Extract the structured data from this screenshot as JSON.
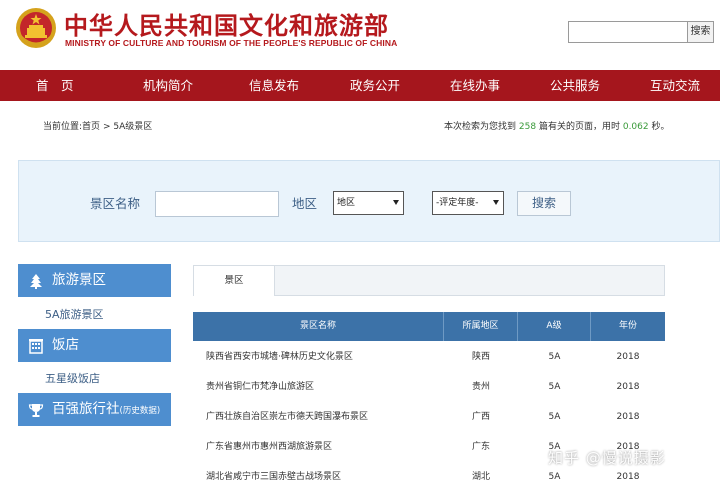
{
  "header": {
    "title_cn": "中华人民共和国文化和旅游部",
    "title_en": "MINISTRY OF CULTURE AND TOURISM OF THE PEOPLE'S REPUBLIC OF CHINA",
    "search_placeholder": "",
    "search_button": "搜索"
  },
  "nav": {
    "items": [
      "首　页",
      "机构简介",
      "信息发布",
      "政务公开",
      "在线办事",
      "公共服务",
      "互动交流"
    ]
  },
  "breadcrumb": {
    "prefix": "当前位置:",
    "home": "首页",
    "separator": ">",
    "current": "5A级景区"
  },
  "result": {
    "before": "本次检索为您找到",
    "count": "258",
    "middle": "篇有关的页面，用时",
    "time": "0.062",
    "unit": "秒。"
  },
  "filter": {
    "name_label": "景区名称",
    "name_value": "",
    "region_label": "地区",
    "region_selected": "地区",
    "year_selected": "-评定年度-",
    "search_button": "搜索"
  },
  "sidebar": {
    "sections": [
      {
        "title": "旅游景区",
        "icon": "tree-icon",
        "sub": "5A旅游景区"
      },
      {
        "title": "饭店",
        "icon": "building-icon",
        "sub": "五星级饭店"
      },
      {
        "title": "百强旅行社",
        "note": "(历史数据)",
        "icon": "trophy-icon"
      }
    ]
  },
  "tabs": {
    "active": "景区"
  },
  "table": {
    "headers": [
      "景区名称",
      "所属地区",
      "A级",
      "年份"
    ],
    "rows": [
      [
        "陕西省西安市城墙·碑林历史文化景区",
        "陕西",
        "5A",
        "2018"
      ],
      [
        "贵州省铜仁市梵净山旅游区",
        "贵州",
        "5A",
        "2018"
      ],
      [
        "广西壮族自治区崇左市德天跨国瀑布景区",
        "广西",
        "5A",
        "2018"
      ],
      [
        "广东省惠州市惠州西湖旅游景区",
        "广东",
        "5A",
        "2018"
      ],
      [
        "湖北省咸宁市三国赤壁古战场景区",
        "湖北",
        "5A",
        "2018"
      ]
    ]
  },
  "watermark": "知乎 @慢说摄影",
  "colors": {
    "brand_red": "#b5191d",
    "nav_red": "#a5161d",
    "sidebar_blue": "#4e8ecf",
    "table_header": "#3c72a8",
    "panel_bg": "#e9f3fb",
    "count_green": "#3a9a3a"
  }
}
